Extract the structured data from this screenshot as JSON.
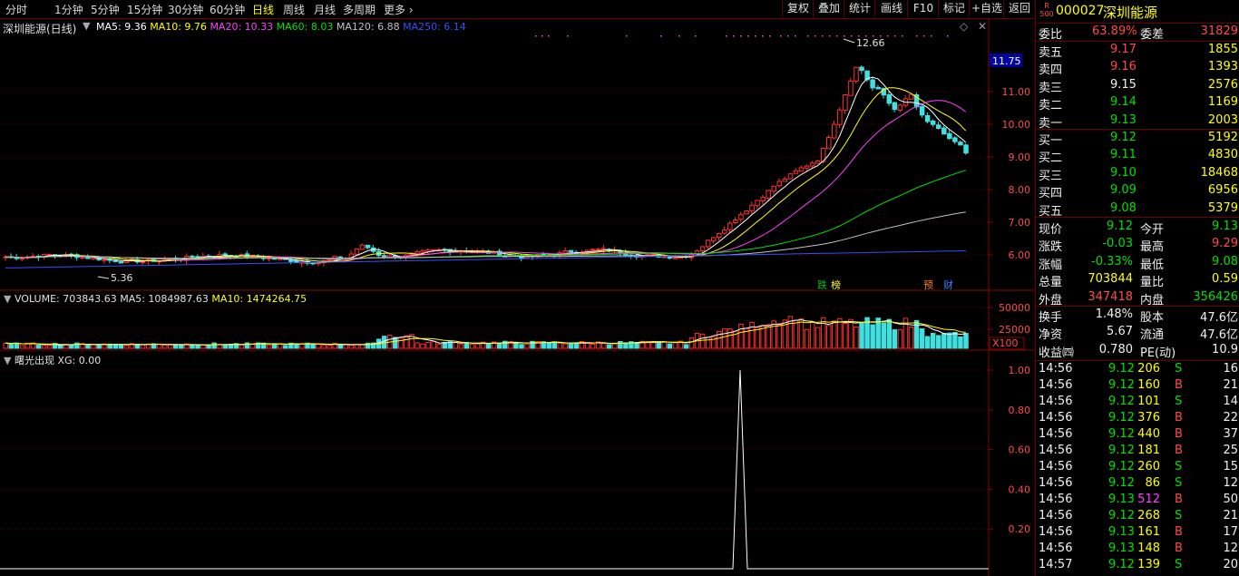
{
  "toolbar": {
    "periods": [
      "分时",
      "1分钟",
      "5分钟",
      "15分钟",
      "30分钟",
      "60分钟",
      "日线",
      "周线",
      "月线",
      "多周期",
      "更多"
    ],
    "active_period": "日线",
    "buttons": [
      "复权",
      "叠加",
      "统计",
      "画线",
      "F10",
      "标记",
      "+自选",
      "返回"
    ]
  },
  "stock": {
    "code": "000027",
    "name": "深圳能源",
    "badge_top": "R",
    "badge_bottom": "500"
  },
  "main_chart": {
    "title": "深圳能源(日线)",
    "ma": [
      {
        "label": "MA5: 9.36",
        "color": "#ffffff"
      },
      {
        "label": "MA10: 9.76",
        "color": "#ffff00"
      },
      {
        "label": "MA20: 10.33",
        "color": "#ff40ff"
      },
      {
        "label": "MA60: 8.03",
        "color": "#00e000"
      },
      {
        "label": "MA120: 6.88",
        "color": "#c0c0c0"
      },
      {
        "label": "MA250: 6.14",
        "color": "#3050ff"
      }
    ],
    "price_ticks": [
      "11.00",
      "10.00",
      "9.00",
      "8.00",
      "7.00",
      "6.00"
    ],
    "current_price_tag": "11.75",
    "high_label": "12.66",
    "low_label": "5.36",
    "markers": [
      "跌",
      "榜",
      "预",
      "财"
    ]
  },
  "volume_chart": {
    "label": "VOLUME: 703843.63",
    "ma5": "MA5: 1084987.63",
    "ma10": "MA10: 1474264.75",
    "ticks": [
      "50000",
      "25000"
    ],
    "unit": "X100"
  },
  "indicator_chart": {
    "title": "曙光出现",
    "value": "XG: 0.00",
    "ticks": [
      "1.00",
      "0.80",
      "0.60",
      "0.40",
      "0.20"
    ]
  },
  "quote": {
    "weibi_label": "委比",
    "weibi": "63.89%",
    "weicha_label": "委差",
    "weicha": "31829",
    "asks": [
      {
        "label": "卖五",
        "price": "9.17",
        "vol": "1855"
      },
      {
        "label": "卖四",
        "price": "9.16",
        "vol": "1393"
      },
      {
        "label": "卖三",
        "price": "9.15",
        "vol": "2576"
      },
      {
        "label": "卖二",
        "price": "9.14",
        "vol": "1169"
      },
      {
        "label": "卖一",
        "price": "9.13",
        "vol": "2003"
      }
    ],
    "bids": [
      {
        "label": "买一",
        "price": "9.12",
        "vol": "5192"
      },
      {
        "label": "买二",
        "price": "9.11",
        "vol": "4830"
      },
      {
        "label": "买三",
        "price": "9.10",
        "vol": "18468"
      },
      {
        "label": "买四",
        "price": "9.09",
        "vol": "6956"
      },
      {
        "label": "买五",
        "price": "9.08",
        "vol": "5379"
      }
    ],
    "stats": [
      {
        "l1": "现价",
        "v1": "9.12",
        "l2": "今开",
        "v2": "9.13"
      },
      {
        "l1": "涨跌",
        "v1": "-0.03",
        "l2": "最高",
        "v2": "9.29"
      },
      {
        "l1": "涨幅",
        "v1": "-0.33%",
        "l2": "最低",
        "v2": "9.08"
      },
      {
        "l1": "总量",
        "v1": "703844",
        "l2": "量比",
        "v2": "0.59"
      },
      {
        "l1": "外盘",
        "v1": "347418",
        "l2": "内盘",
        "v2": "356426"
      }
    ],
    "stats2": [
      {
        "l1": "换手",
        "v1": "1.48%",
        "l2": "股本",
        "v2": "47.6亿"
      },
      {
        "l1": "净资",
        "v1": "5.67",
        "l2": "流通",
        "v2": "47.6亿"
      },
      {
        "l1": "收益㈣",
        "v1": "0.780",
        "l2": "PE(动)",
        "v2": "10.9"
      }
    ]
  },
  "ticks": [
    {
      "time": "14:56",
      "price": "9.12",
      "vol": "206",
      "bs": "S",
      "n": "16"
    },
    {
      "time": "14:56",
      "price": "9.12",
      "vol": "160",
      "bs": "B",
      "n": "21"
    },
    {
      "time": "14:56",
      "price": "9.12",
      "vol": "101",
      "bs": "S",
      "n": "14"
    },
    {
      "time": "14:56",
      "price": "9.12",
      "vol": "376",
      "bs": "B",
      "n": "22"
    },
    {
      "time": "14:56",
      "price": "9.12",
      "vol": "440",
      "bs": "B",
      "n": "37"
    },
    {
      "time": "14:56",
      "price": "9.12",
      "vol": "181",
      "bs": "B",
      "n": "25"
    },
    {
      "time": "14:56",
      "price": "9.12",
      "vol": "260",
      "bs": "S",
      "n": "15"
    },
    {
      "time": "14:56",
      "price": "9.12",
      "vol": "86",
      "bs": "S",
      "n": "12"
    },
    {
      "time": "14:56",
      "price": "9.13",
      "vol": "512",
      "bs": "B",
      "n": "50"
    },
    {
      "time": "14:56",
      "price": "9.12",
      "vol": "268",
      "bs": "S",
      "n": "21"
    },
    {
      "time": "14:56",
      "price": "9.13",
      "vol": "161",
      "bs": "B",
      "n": "17"
    },
    {
      "time": "14:56",
      "price": "9.13",
      "vol": "148",
      "bs": "B",
      "n": "12"
    },
    {
      "time": "14:57",
      "price": "9.12",
      "vol": "139",
      "bs": "S",
      "n": "20"
    }
  ]
}
